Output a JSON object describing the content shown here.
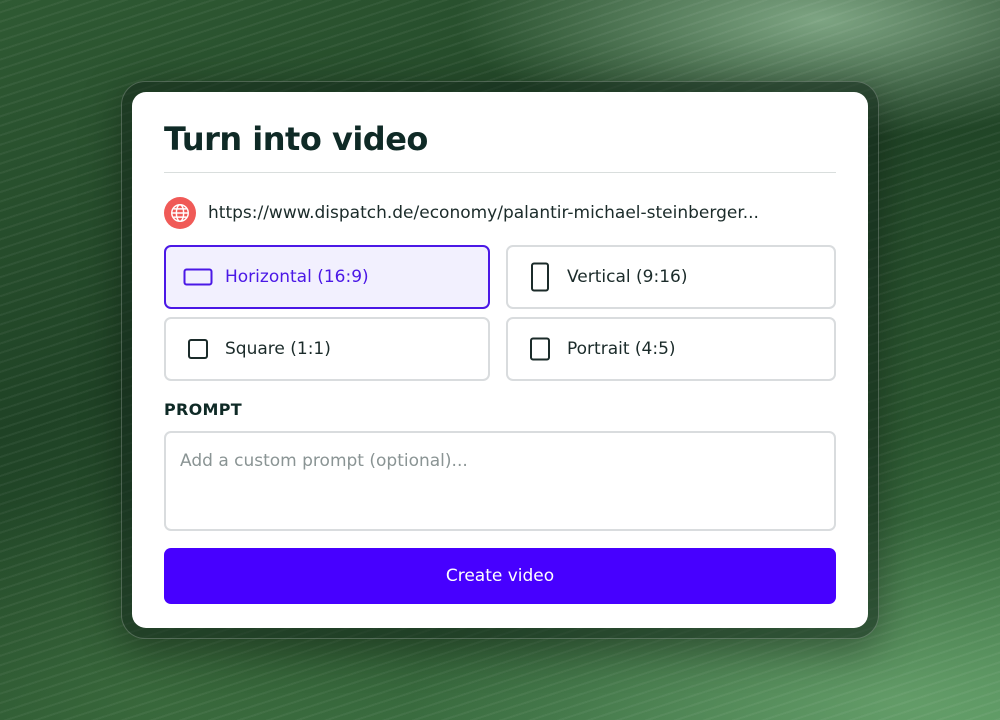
{
  "dialog": {
    "title": "Turn into video"
  },
  "source": {
    "url": "https://www.dispatch.de/economy/palantir-michael-steinberger...",
    "icon": "globe-icon",
    "icon_bg": "#f05a57"
  },
  "formats": [
    {
      "label": "Horizontal (16:9)",
      "icon": "landscape-frame-icon",
      "selected": true
    },
    {
      "label": "Vertical (9:16)",
      "icon": "portrait-frame-icon",
      "selected": false
    },
    {
      "label": "Square (1:1)",
      "icon": "square-frame-icon",
      "selected": false
    },
    {
      "label": "Portrait (4:5)",
      "icon": "portrait-4-5-frame-icon",
      "selected": false
    }
  ],
  "prompt": {
    "label": "PROMPT",
    "placeholder": "Add a custom prompt (optional)...",
    "value": ""
  },
  "actions": {
    "create_label": "Create video"
  },
  "colors": {
    "accent": "#4700ff",
    "selected_border": "#4b18e6",
    "selected_bg": "#f2f0fe",
    "title": "#0f2a26"
  }
}
